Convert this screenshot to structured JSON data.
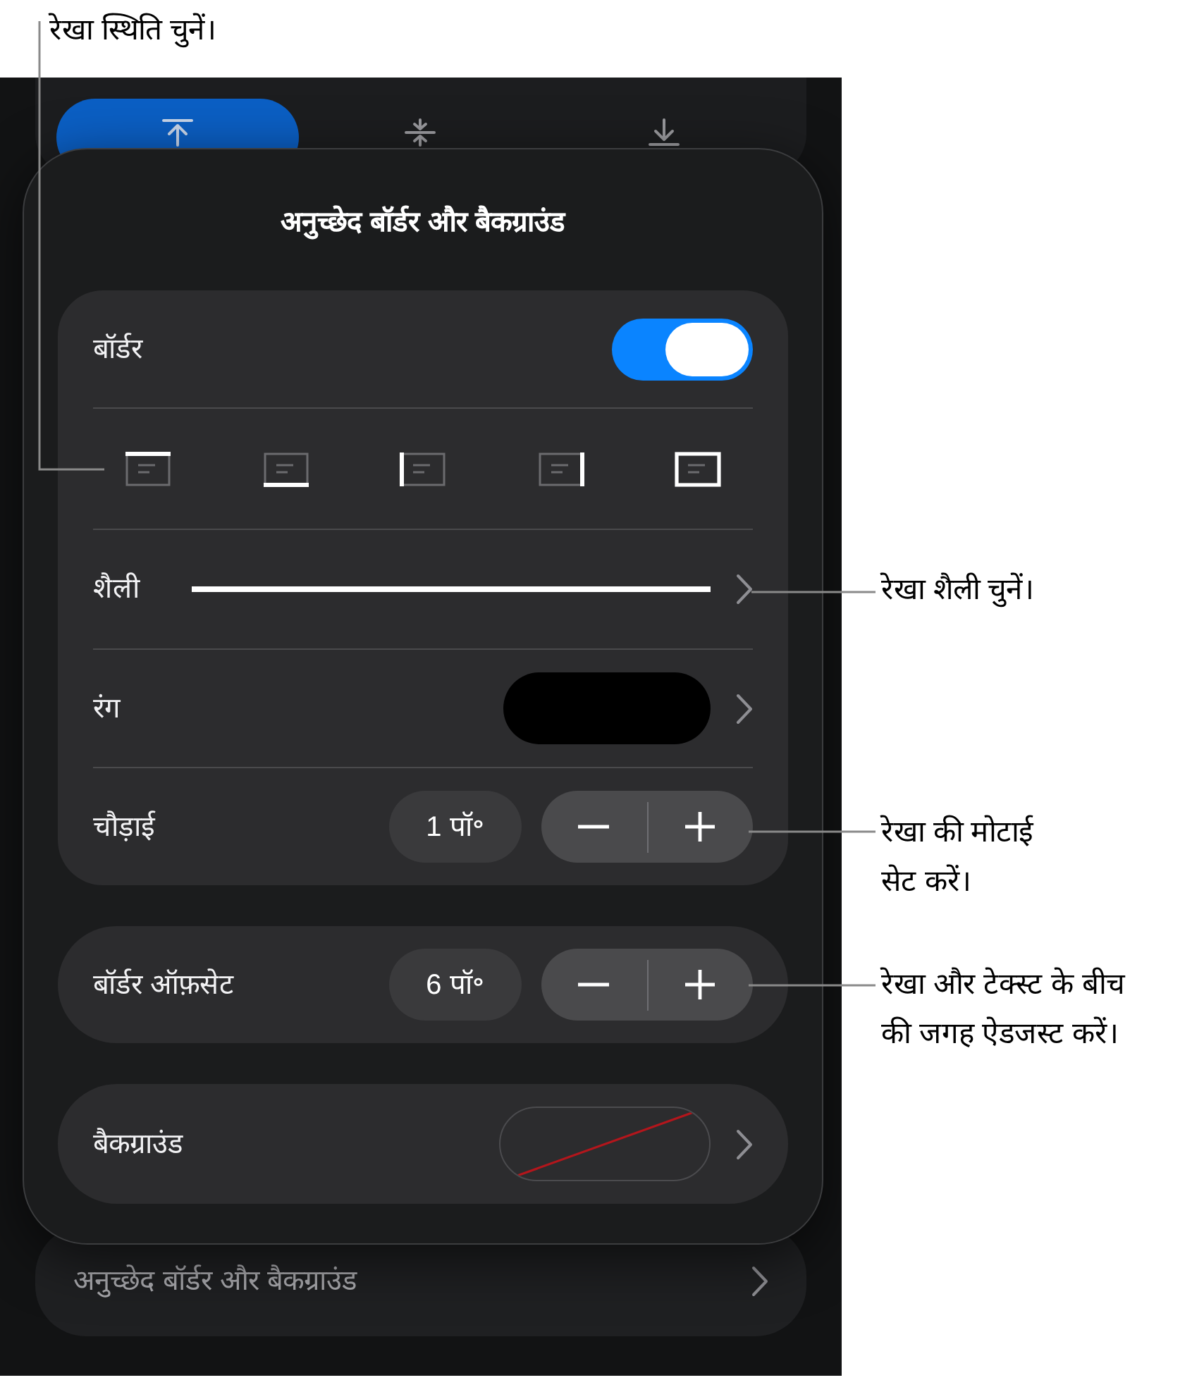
{
  "callouts": [
    {
      "kind": "position",
      "lines": [
        "रेखा स्थिति चुनें।"
      ]
    },
    {
      "kind": "style",
      "lines": [
        "रेखा शैली चुनें।"
      ]
    },
    {
      "kind": "width",
      "lines": [
        "रेखा की मोटाई",
        "सेट करें।"
      ]
    },
    {
      "kind": "offset",
      "lines": [
        "रेखा और टेक्स्ट के बीच",
        "की जगह ऐडजस्ट करें।"
      ]
    }
  ],
  "alignment_tabs": [
    {
      "kind": "top",
      "selected": true
    },
    {
      "kind": "middle",
      "selected": false
    },
    {
      "kind": "bottom",
      "selected": false
    }
  ],
  "popover": {
    "title": "अनुच्छेद बॉर्डर और बैकग्राउंड",
    "groups": [
      {
        "rows": [
          {
            "kind": "toggle",
            "label": "बॉर्डर",
            "on": true
          },
          {
            "kind": "edges",
            "options": [
              {
                "kind": "top"
              },
              {
                "kind": "bottom"
              },
              {
                "kind": "left"
              },
              {
                "kind": "right"
              },
              {
                "kind": "all"
              }
            ]
          },
          {
            "kind": "line_style",
            "label": "शैली"
          },
          {
            "kind": "color",
            "label": "रंग",
            "color": "#000000"
          },
          {
            "kind": "stepper",
            "label": "चौड़ाई",
            "value": "1 पॉ॰"
          }
        ]
      },
      {
        "rows": [
          {
            "kind": "stepper",
            "label": "बॉर्डर ऑफ़सेट",
            "value": "6 पॉ॰"
          }
        ]
      },
      {
        "rows": [
          {
            "kind": "no_fill",
            "label": "बैकग्राउंड"
          }
        ]
      }
    ]
  },
  "menu_row": {
    "label": "अनुच्छेद बॉर्डर और बैकग्राउंड"
  }
}
